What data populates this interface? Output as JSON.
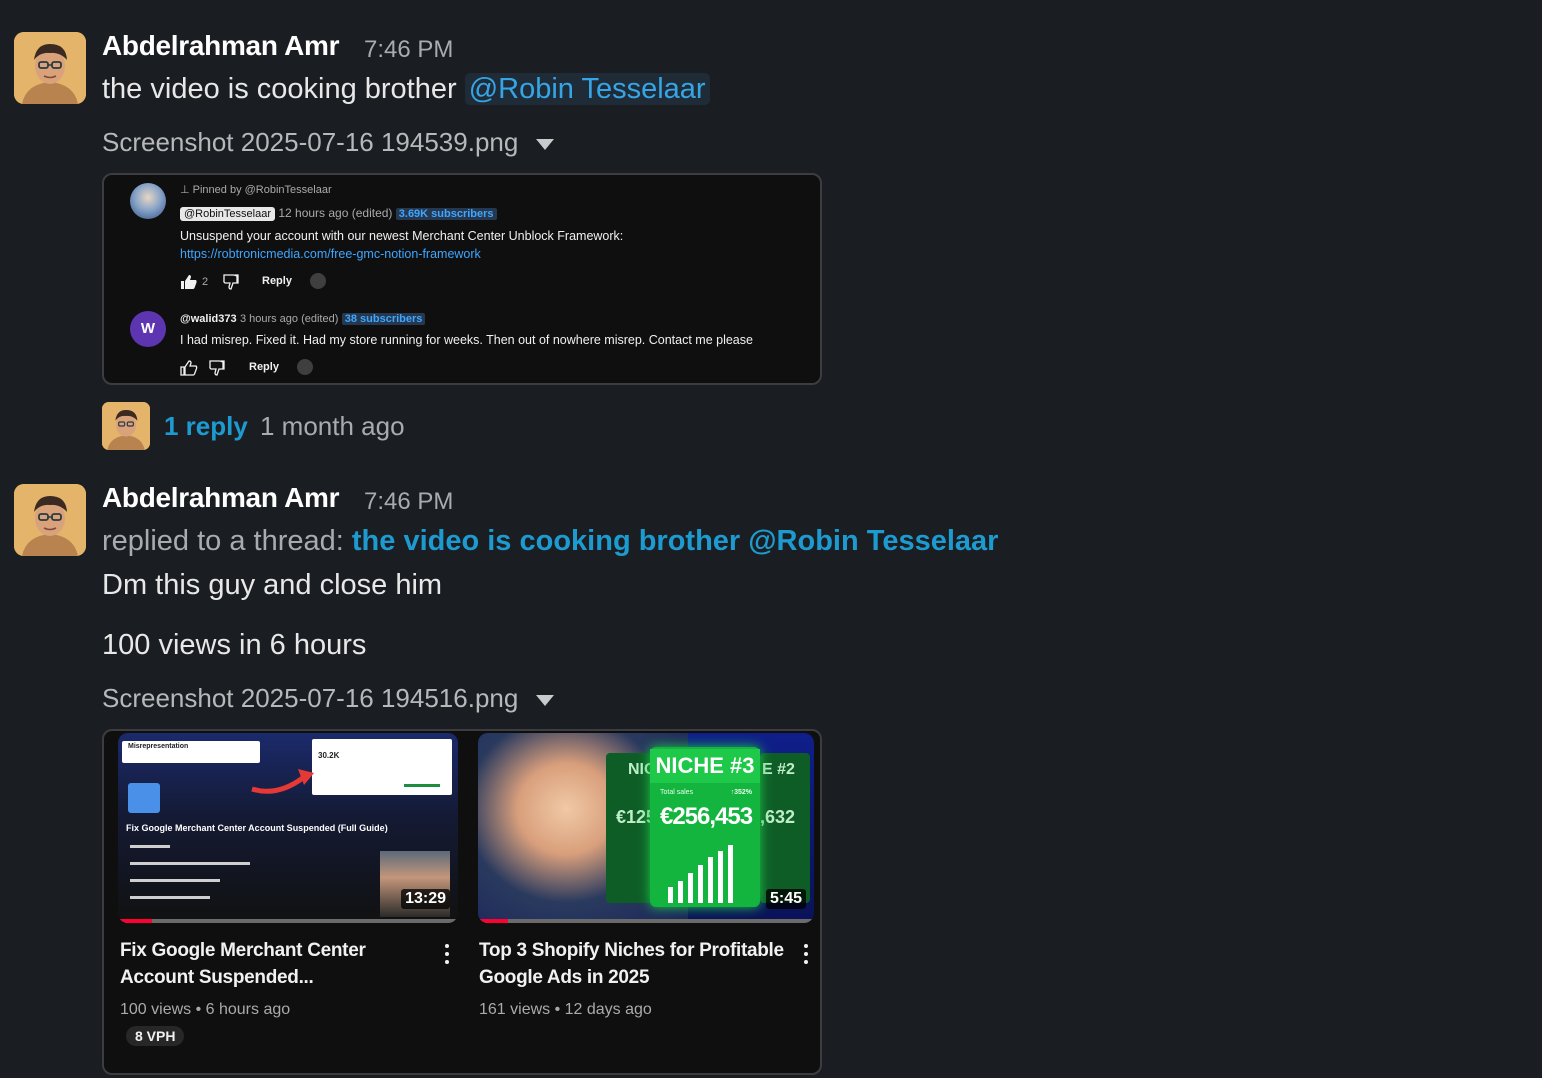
{
  "message1": {
    "author": "Abdelrahman Amr",
    "time": "7:46 PM",
    "text": "the video is cooking brother",
    "mention": "@Robin Tesselaar",
    "file_name": "Screenshot 2025-07-16 194539.png",
    "screenshot": {
      "pinned": "Pinned by @RobinTesselaar",
      "c1_handle": "@RobinTesselaar",
      "c1_meta": "12 hours ago (edited)",
      "c1_subs": "3.69K subscribers",
      "c1_text": "Unsuspend your account with our newest Merchant Center Unblock Framework:",
      "c1_link": "https://robtronicmedia.com/free-gmc-notion-framework",
      "c1_likes": "2",
      "c1_reply": "Reply",
      "c2_avatar_letter": "W",
      "c2_handle": "@walid373",
      "c2_meta": "3 hours ago (edited)",
      "c2_subs": "38 subscribers",
      "c2_text": "I had misrep. Fixed it. Had my store running for weeks. Then out of nowhere misrep. Contact me please",
      "c2_reply": "Reply"
    },
    "thread": {
      "replies": "1 reply",
      "last": "1 month ago"
    }
  },
  "message2": {
    "author": "Abdelrahman Amr",
    "time": "7:46 PM",
    "replied_prefix": "replied to a thread:",
    "replied_link": "the video is cooking brother @Robin Tesselaar",
    "line1": "Dm this guy and close him",
    "line2": "100 views in 6 hours",
    "file_name": "Screenshot 2025-07-16 194516.png",
    "videos": [
      {
        "title_line1": "Fix Google Merchant Center",
        "title_line2": "Account Suspended...",
        "meta": "100 views • 6 hours ago",
        "badge": "8 VPH",
        "duration": "13:29",
        "thumb_heading": "Fix Google Merchant Center Account Suspended (Full Guide)",
        "thumb_card_title": "Misrepresentation",
        "thumb_value": "30.2K",
        "progress": 0.1
      },
      {
        "title_line1": "Top 3 Shopify Niches for Profitable",
        "title_line2": "Google Ads in 2025",
        "meta": "161 views • 12 days ago",
        "duration": "5:45",
        "thumb_niche": "NICHE #3",
        "thumb_total_label": "Total sales",
        "thumb_pct": "↑352%",
        "thumb_amount": "€256,453",
        "thumb_left_amount": "€125",
        "thumb_right_amount": ",632",
        "thumb_left_niche": "NICH",
        "thumb_right_niche": "E #2",
        "progress": 0.09
      }
    ]
  },
  "colors": {
    "background": "#1a1d21",
    "link": "#1d9bd1",
    "mention": "#36a5e6",
    "youtube_red": "#ff0033",
    "niche_green": "#1ec94a"
  }
}
